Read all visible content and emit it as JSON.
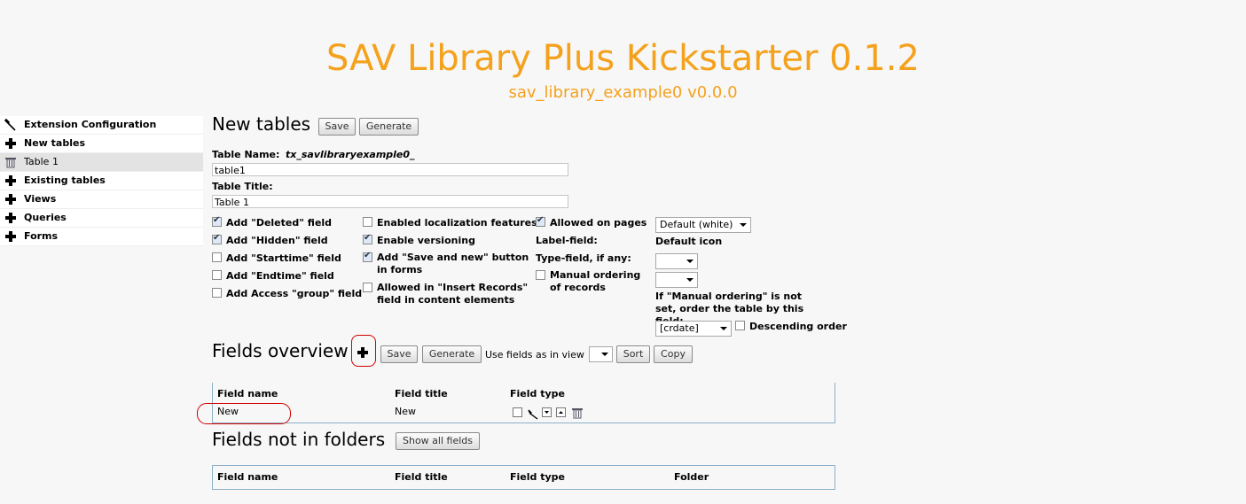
{
  "header": {
    "title": "SAV Library Plus Kickstarter 0.1.2",
    "subtitle": "sav_library_example0 v0.0.0"
  },
  "sidebar": {
    "items": [
      {
        "label": "Extension Configuration",
        "icon": "wrench-icon"
      },
      {
        "label": "New tables",
        "icon": "plus-icon"
      },
      {
        "label": "Table 1",
        "icon": "trash-icon"
      },
      {
        "label": "Existing tables",
        "icon": "plus-icon"
      },
      {
        "label": "Views",
        "icon": "plus-icon"
      },
      {
        "label": "Queries",
        "icon": "plus-icon"
      },
      {
        "label": "Forms",
        "icon": "plus-icon"
      }
    ]
  },
  "new_tables": {
    "heading": "New tables",
    "save_label": "Save",
    "generate_label": "Generate",
    "table_name_label": "Table Name:",
    "table_name_prefix": "tx_savlibraryexample0_",
    "table_name_value": "table1",
    "table_title_label": "Table Title:",
    "table_title_value": "Table 1",
    "options_col1": [
      {
        "label": "Add \"Deleted\" field",
        "checked": true
      },
      {
        "label": "Add \"Hidden\" field",
        "checked": true
      },
      {
        "label": "Add \"Starttime\" field",
        "checked": false
      },
      {
        "label": "Add \"Endtime\" field",
        "checked": false
      },
      {
        "label": "Add Access \"group\" field",
        "checked": false
      }
    ],
    "options_col2": [
      {
        "label": "Enabled localization features",
        "checked": false
      },
      {
        "label": "Enable versioning",
        "checked": true
      },
      {
        "label": "Add \"Save and new\" button in forms",
        "checked": true
      },
      {
        "label": "Allowed in \"Insert Records\" field in content elements",
        "checked": false
      }
    ],
    "allowed_on_pages_label": "Allowed on pages",
    "allowed_on_pages_checked": true,
    "label_field_label": "Label-field:",
    "type_field_label": "Type-field, if any:",
    "manual_ordering_label": "Manual ordering of records",
    "manual_ordering_checked": false,
    "default_select_value": "Default (white)",
    "default_icon_label": "Default icon",
    "order_note": "If \"Manual ordering\" is not set, order the table by this field:",
    "order_select_value": "[crdate]",
    "descending_label": "Descending order",
    "descending_checked": false
  },
  "fields_overview": {
    "heading": "Fields overview",
    "save_label": "Save",
    "generate_label": "Generate",
    "use_fields_label": "Use fields as in view",
    "sort_label": "Sort",
    "copy_label": "Copy",
    "columns": [
      "Field name",
      "Field title",
      "Field type"
    ],
    "rows": [
      {
        "field_name": "New",
        "field_title": "New"
      }
    ]
  },
  "fields_not_in_folders": {
    "heading": "Fields not in folders",
    "show_all_label": "Show all fields",
    "columns": [
      "Field name",
      "Field title",
      "Field type",
      "Folder"
    ]
  },
  "colors": {
    "title": "#f4a11c",
    "highlight": "#d20000",
    "table_border": "#8cb0c8"
  }
}
